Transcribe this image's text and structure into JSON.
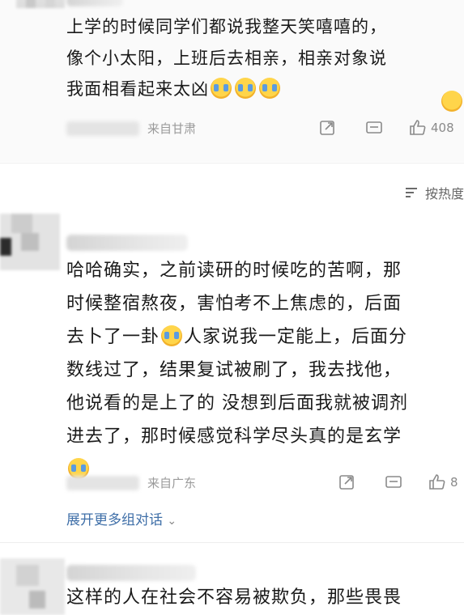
{
  "comments": [
    {
      "text_lines": [
        "上学的时候同学们都说我整天笑嘻嘻的，",
        "像个小太阳，上班后去相亲，相亲对象说",
        "我面相看起来太凶"
      ],
      "location": "来自甘肃",
      "likes": "408"
    },
    {
      "text_lines": [
        "哈哈确实，之前读研的时候吃的苦啊，那",
        "时候整宿熬夜，害怕考不上焦虑的，后面",
        "去卜了一卦",
        "人家说我一定能上，后面分",
        "数线过了，结果复试被刷了，我去找他，",
        "他说看的是上了的 没想到后面我就被调剂",
        "进去了，那时候感觉科学尽头真的是玄学"
      ],
      "location": "来自广东",
      "likes": "8",
      "expand_label": "展开更多组对话"
    },
    {
      "text_lines": [
        "这样的人在社会不容易被欺负，那些畏畏"
      ]
    }
  ],
  "sort_label": "按热度",
  "icons": {
    "share": "share-icon",
    "comment": "comment-icon",
    "like": "thumb-up-icon",
    "emoji": "crying-face-icon"
  }
}
